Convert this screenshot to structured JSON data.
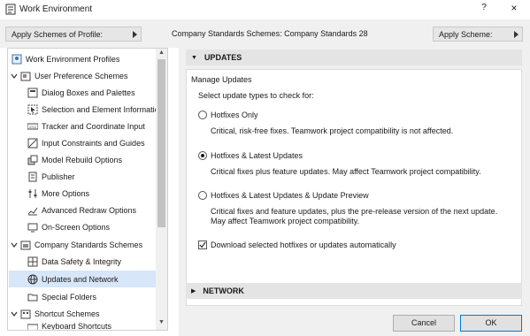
{
  "window": {
    "title": "Work Environment",
    "help": "?",
    "close": "×"
  },
  "toolbar": {
    "apply_profile_label": "Apply Schemes of Profile:",
    "scheme_caption": "Company Standards Schemes: ",
    "scheme_name": "Company Standards 28",
    "apply_scheme_label": "Apply Scheme:"
  },
  "sidebar": {
    "items": [
      {
        "label": "Work Environment Profiles"
      },
      {
        "label": "User Preference Schemes"
      },
      {
        "label": "Dialog Boxes and Palettes"
      },
      {
        "label": "Selection and Element Information"
      },
      {
        "label": "Tracker and Coordinate Input"
      },
      {
        "label": "Input Constraints and Guides"
      },
      {
        "label": "Model Rebuild Options"
      },
      {
        "label": "Publisher"
      },
      {
        "label": "More Options"
      },
      {
        "label": "Advanced Redraw Options"
      },
      {
        "label": "On-Screen Options"
      },
      {
        "label": "Company Standards Schemes"
      },
      {
        "label": "Data Safety & Integrity"
      },
      {
        "label": "Updates and Network"
      },
      {
        "label": "Special Folders"
      },
      {
        "label": "Shortcut Schemes"
      },
      {
        "label": "Keyboard Shortcuts"
      }
    ]
  },
  "updates": {
    "header": "UPDATES",
    "manage_label": "Manage Updates",
    "select_label": "Select update types to check for:",
    "options": [
      {
        "label": "Hotfixes Only",
        "desc1": "Critical, risk-free fixes. Teamwork project compatibility is not affected.",
        "desc2": ""
      },
      {
        "label": "Hotfixes & Latest Updates",
        "desc1": "Critical fixes plus feature updates. May affect Teamwork project compatibility.",
        "desc2": ""
      },
      {
        "label": "Hotfixes & Latest Updates & Update Preview",
        "desc1": "Critical fixes and feature updates, plus the pre-release version of the next update.",
        "desc2": "May affect Teamwork project compatibility."
      }
    ],
    "selected_index": 1,
    "auto_download_label": "Download selected hotfixes or updates automatically",
    "auto_download_checked": true
  },
  "network": {
    "header": "NETWORK"
  },
  "footer": {
    "cancel": "Cancel",
    "ok": "OK"
  }
}
